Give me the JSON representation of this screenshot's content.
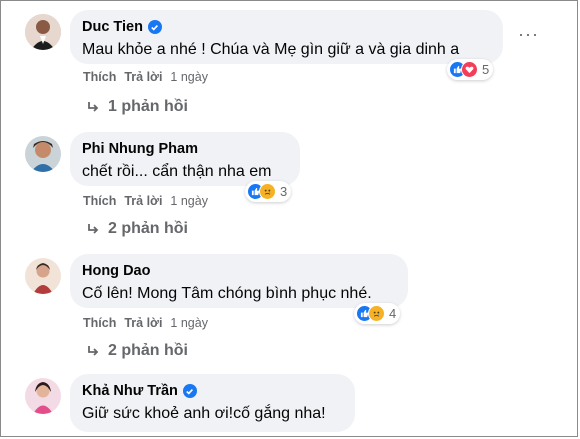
{
  "comments": [
    {
      "name": "Duc Tien",
      "verified": true,
      "text": "Mau khỏe a nhé ! Chúa và Mẹ gìn giữ a và gia dinh a",
      "like": "Thích",
      "reply": "Trả lời",
      "time": "1 ngày",
      "reactions": [
        "like-icon",
        "love-icon"
      ],
      "reaction_count": "5",
      "replies": "1 phản hồi",
      "more": "···"
    },
    {
      "name": "Phi Nhung Pham",
      "verified": false,
      "text": "chết rồi... cẩn thận nha em",
      "like": "Thích",
      "reply": "Trả lời",
      "time": "1 ngày",
      "reactions": [
        "like-icon",
        "sad-icon"
      ],
      "reaction_count": "3",
      "replies": "2 phản hồi"
    },
    {
      "name": "Hong Dao",
      "verified": false,
      "text": "Cố lên! Mong Tâm chóng bình phục nhé.",
      "like": "Thích",
      "reply": "Trả lời",
      "time": "1 ngày",
      "reactions": [
        "like-icon",
        "sad-icon"
      ],
      "reaction_count": "4",
      "replies": "2 phản hồi"
    },
    {
      "name": "Khả Như Trần",
      "verified": true,
      "text": "Giữ sức khoẻ anh ơi!cố gắng nha!"
    }
  ],
  "colors": {
    "blue": "#1877f2",
    "love": "#f33e58",
    "sad": "#f7b125",
    "bubble": "#f0f2f5",
    "meta": "#65676b"
  }
}
